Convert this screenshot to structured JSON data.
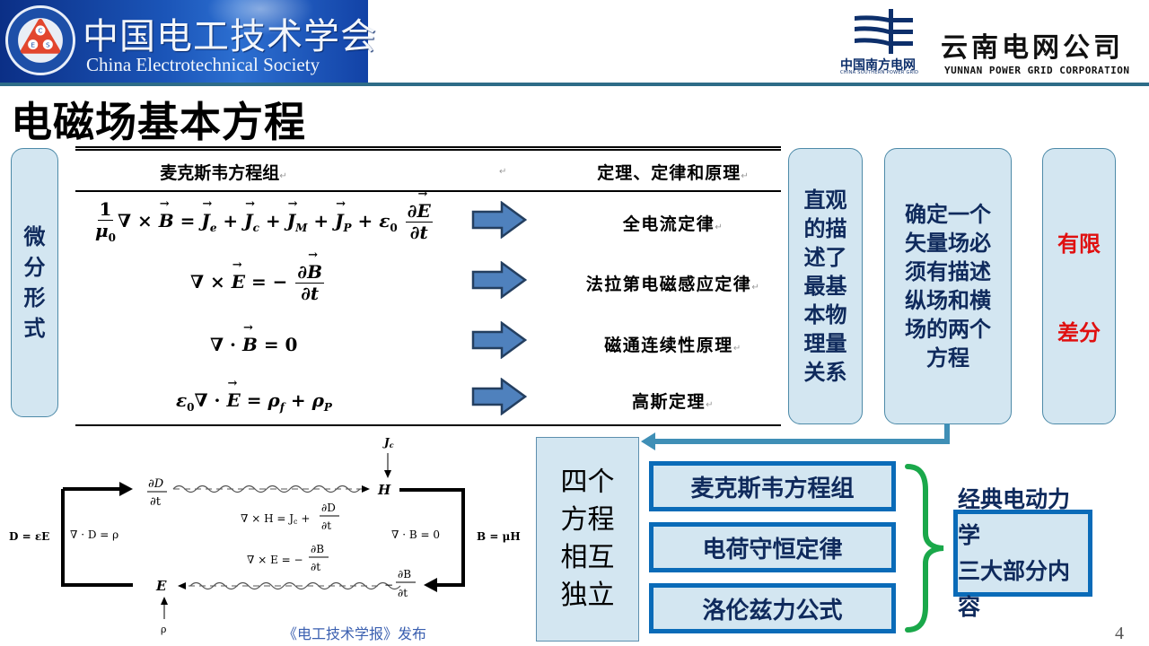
{
  "header": {
    "society_cn": "中国电工技术学会",
    "society_en": "China Electrotechnical Society",
    "society_logo_letters": [
      "C",
      "E",
      "S"
    ],
    "csg_cn": "中国南方电网",
    "csg_en": "CHINA SOUTHERN POWER GRID",
    "company_cn": "云南电网公司",
    "company_en": "YUNNAN POWER GRID CORPORATION"
  },
  "page_title": "电磁场基本方程",
  "side_label": "微分形式",
  "table": {
    "head_left": "麦克斯韦方程组",
    "head_right": "定理、定律和原理",
    "rows": [
      {
        "law": "全电流定律"
      },
      {
        "law": "法拉第电磁感应定律"
      },
      {
        "law": "磁通连续性原理"
      },
      {
        "law": "高斯定理"
      }
    ],
    "paragraph_mark": "↵"
  },
  "panels": {
    "intuitive": "直观的描述了最基本物理量关系",
    "vector": "确定一个矢量场必须有描述纵场和横场的两个方程",
    "finite_1": "有限",
    "finite_2": "差分"
  },
  "diagram": {
    "labels": {
      "dDdt": "∂D/∂t",
      "H": "H",
      "E": "E",
      "Jc": "J_c",
      "rho": "ρ",
      "D_eq": "D = εE",
      "divD": "∇ · D = ρ",
      "divB": "∇ · B = 0",
      "B_eq": "B = μH",
      "curlH": "∇ × H = J_c + ∂D/∂t",
      "curlE": "∇ × E = − ∂B/∂t",
      "minus_dBdt": "− ∂B/∂t"
    },
    "credit": "《电工技术学报》发布"
  },
  "summary": {
    "independent": "四个方程相互独立",
    "items": [
      "麦克斯韦方程组",
      "电荷守恒定律",
      "洛伦兹力公式"
    ],
    "classical_1": "经典电动力学",
    "classical_2": "三大部分内容"
  },
  "page_number": "4",
  "colors": {
    "panel_fill": "#d3e6f1",
    "panel_text": "#0f2a5c",
    "accent_blue": "#0a6bb8",
    "red": "#e01010",
    "brace_green": "#1aa84a",
    "connector": "#3f8fb6"
  }
}
